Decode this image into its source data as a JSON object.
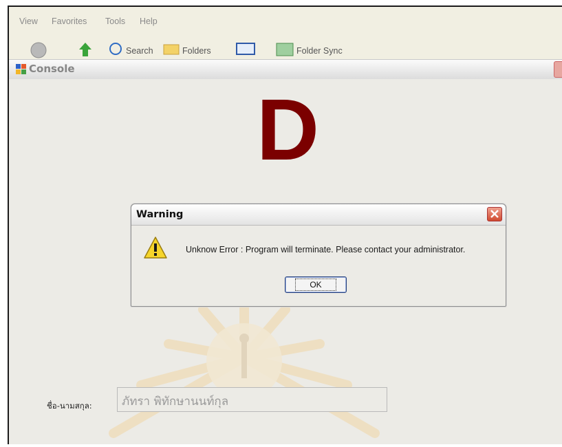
{
  "menubar": {
    "items": [
      "View",
      "Favorites",
      "Tools",
      "Help"
    ]
  },
  "toolbar": {
    "search_label": "Search",
    "folders_label": "Folders",
    "folder_sync_label": "Folder Sync"
  },
  "console_window": {
    "title": "Console",
    "big_letter": "D",
    "big_letter_color": "#7b0000"
  },
  "dialog": {
    "title": "Warning",
    "message": "Unknow Error : Program will terminate. Please contact your administrator.",
    "ok_label": "OK"
  },
  "form": {
    "name_label": "ชื่อ-นามสกุล:",
    "name_value": "ภัทรา พิทักษานนท์กุล"
  },
  "colors": {
    "close_red": "#d04a30",
    "warning_yellow": "#f6d52b"
  }
}
